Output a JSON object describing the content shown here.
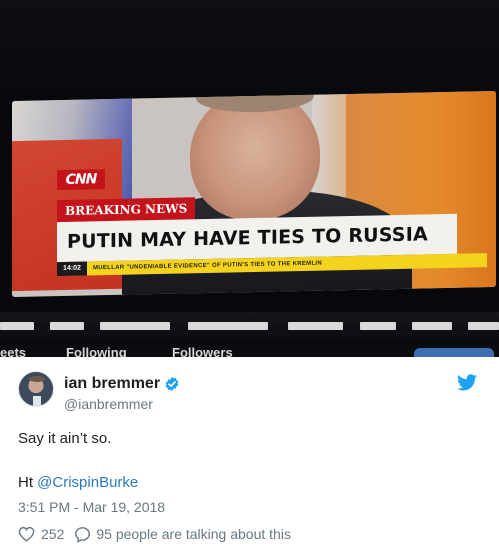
{
  "photo": {
    "cnn_logo": "CNN",
    "breaking_label": "BREAKING NEWS",
    "headline": "PUTIN MAY HAVE TIES TO RUSSIA",
    "ticker_time": "14:02",
    "ticker_text": "MUELLAR \"UNDENIABLE EVIDENCE\" OF PUTIN'S TIES TO THE KREMLIN",
    "bottom_partial": [
      "eets",
      "Following",
      "Followers"
    ]
  },
  "tweet": {
    "author_name": "ian bremmer",
    "author_handle": "@ianbremmer",
    "text": "Say it ain’t so.",
    "ht_prefix": "Ht ",
    "ht_mention": "@CrispinBurke",
    "timestamp": "3:51 PM - Mar 19, 2018",
    "like_count": "252",
    "talking_text": "95 people are talking about this"
  },
  "colors": {
    "link": "#2b7bb9",
    "verified": "#1da1f2",
    "meta": "#697882",
    "cnn_red": "#c4141b",
    "ticker_yellow": "#f4d31f"
  },
  "icons": [
    "verified-icon",
    "twitter-bird-icon",
    "heart-icon",
    "reply-icon"
  ]
}
